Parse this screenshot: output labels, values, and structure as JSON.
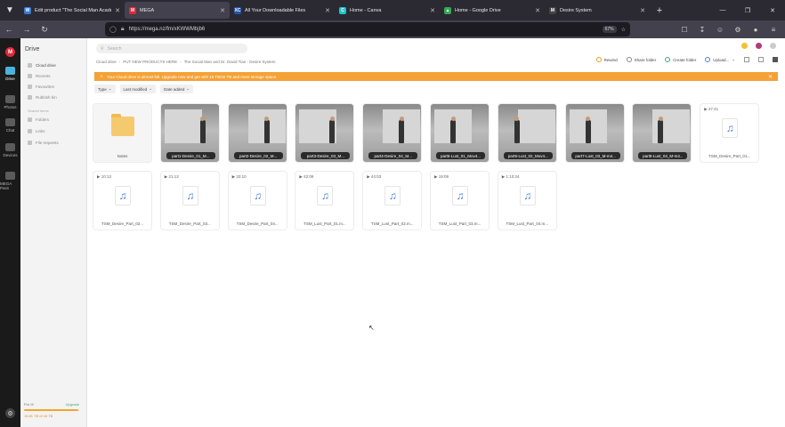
{
  "browser": {
    "tabs": [
      {
        "title": "Edit product \"The Social Man Acaden…",
        "color": "#3a7bd5",
        "glyph": "W",
        "active": false
      },
      {
        "title": "MEGA",
        "color": "#e0283a",
        "glyph": "M",
        "active": true
      },
      {
        "title": "All Your Downloadable Files",
        "color": "#2255aa",
        "glyph": "XC",
        "active": false
      },
      {
        "title": "Home - Canva",
        "color": "#20c4cb",
        "glyph": "C",
        "active": false
      },
      {
        "title": "Home - Google Drive",
        "color": "#34a853",
        "glyph": "▲",
        "active": false
      },
      {
        "title": "Desire System",
        "color": "#444444",
        "glyph": "M",
        "active": false
      }
    ],
    "url": "https://mega.nz/fm/xKWWMbjb6",
    "zoom": "67%"
  },
  "rail": {
    "items": [
      {
        "label": "Drive",
        "active": true
      },
      {
        "label": "Photos",
        "active": false
      },
      {
        "label": "Chat",
        "active": false
      },
      {
        "label": "Devices",
        "active": false
      },
      {
        "label": "MEGA Pass",
        "active": false
      }
    ]
  },
  "sidebar": {
    "title": "Drive",
    "items": [
      {
        "label": "Cloud drive",
        "active": true
      },
      {
        "label": "Recents",
        "active": false
      },
      {
        "label": "Favourites",
        "active": false
      },
      {
        "label": "Rubbish bin",
        "active": false
      }
    ],
    "section": "Shared items",
    "shared": [
      {
        "label": "Folders"
      },
      {
        "label": "Links"
      },
      {
        "label": "File requests"
      }
    ],
    "storage": {
      "plan": "Pro III",
      "upgrade": "Upgrade",
      "used_text": "15.81 TB of 16 TB",
      "fraction": 0.99
    }
  },
  "main": {
    "search_placeholder": "Search",
    "breadcrumb": [
      "Cloud drive",
      "PUT NEW PRODUCTS HERE",
      "The Social Man and Dr. David Tian - Desire System"
    ],
    "actions": {
      "rewind": "Rewind",
      "share": "Share folder",
      "create": "Create folder",
      "upload": "Upload..."
    },
    "banner": "Your Cloud drive is almost full. Upgrade now and get with 16 TB/32 TB and more storage space.",
    "filters": [
      "Type",
      "Last modified",
      "Date added"
    ],
    "folder": {
      "name": "Notes"
    },
    "videos": [
      {
        "name": "part1-Desire_01_M..."
      },
      {
        "name": "part2-Desire_02_M..."
      },
      {
        "name": "part3-Desire_03_M..."
      },
      {
        "name": "part4-Desire_04_M..."
      },
      {
        "name": "part5-Lust_01_Mov4..."
      },
      {
        "name": "part6-Lust_02_Mov4..."
      },
      {
        "name": "part7-Lust_03_M-m4..."
      },
      {
        "name": "part8-Lust_04_M-m4..."
      }
    ],
    "audio": [
      {
        "name": "TSM_Desire_Part_01...",
        "duration": "27:41"
      },
      {
        "name": "TSM_Desire_Part_02...",
        "duration": "10:13"
      },
      {
        "name": "TSM_Desire_Part_03...",
        "duration": "21:13"
      },
      {
        "name": "TSM_Desire_Part_04...",
        "duration": "33:10"
      },
      {
        "name": "TSM_Lust_Part_01.m...",
        "duration": "42:09"
      },
      {
        "name": "TSM_Lust_Part_02.m...",
        "duration": "44:03"
      },
      {
        "name": "TSM_Lust_Part_03.m...",
        "duration": "19:09"
      },
      {
        "name": "TSM_Lust_Part_04.m...",
        "duration": "1:10:24"
      }
    ]
  }
}
